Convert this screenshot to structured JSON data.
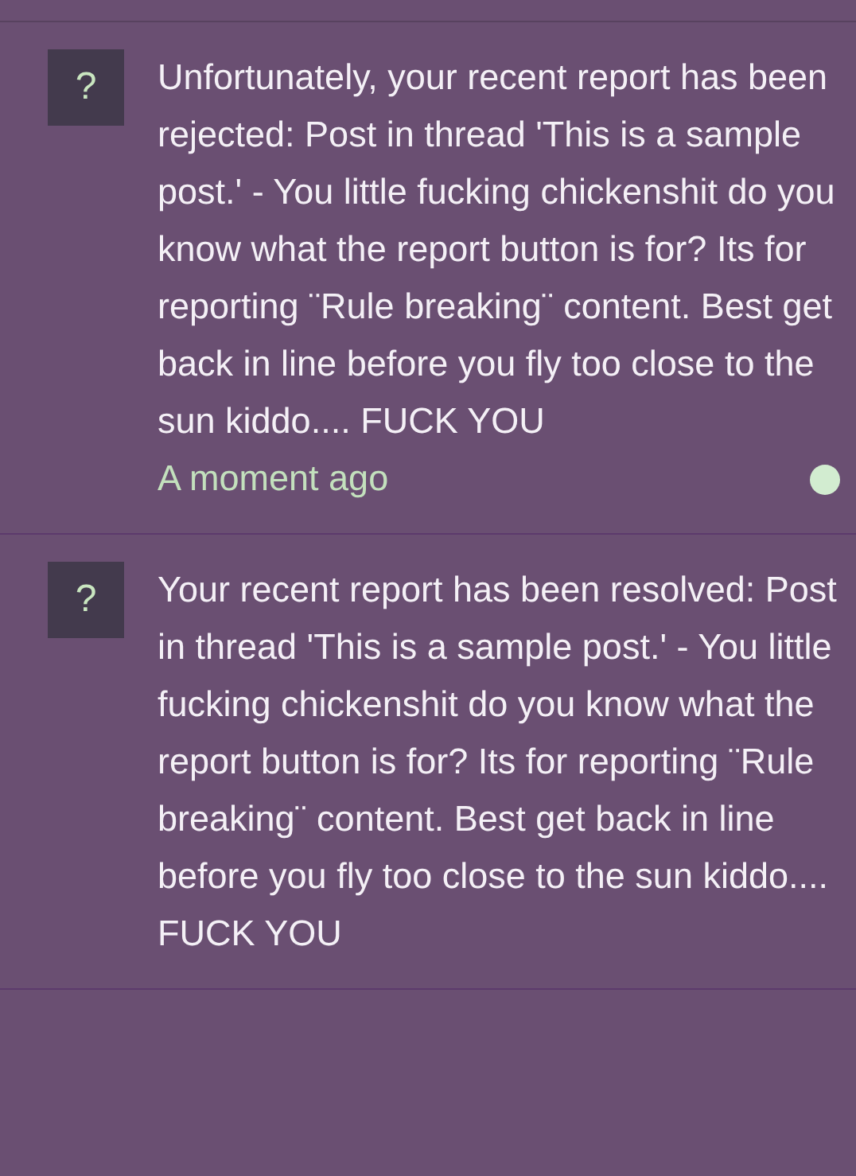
{
  "notifications": [
    {
      "icon": "?",
      "text": "Unfortunately, your recent report has been rejected: Post in thread 'This is a sample post.' - You little fucking chickenshit do you know what the report button is for? Its for reporting ¨Rule breaking¨ content. Best get back in line before you fly too close to the sun kiddo.... FUCK YOU",
      "time": "A moment ago",
      "unread": true
    },
    {
      "icon": "?",
      "text": "Your recent report has been resolved: Post in thread 'This is a sample post.' - You little fucking chickenshit do you know what the report button is for? Its for reporting ¨Rule breaking¨ content. Best get back in line before you fly too close to the sun kiddo.... FUCK YOU"
    }
  ]
}
